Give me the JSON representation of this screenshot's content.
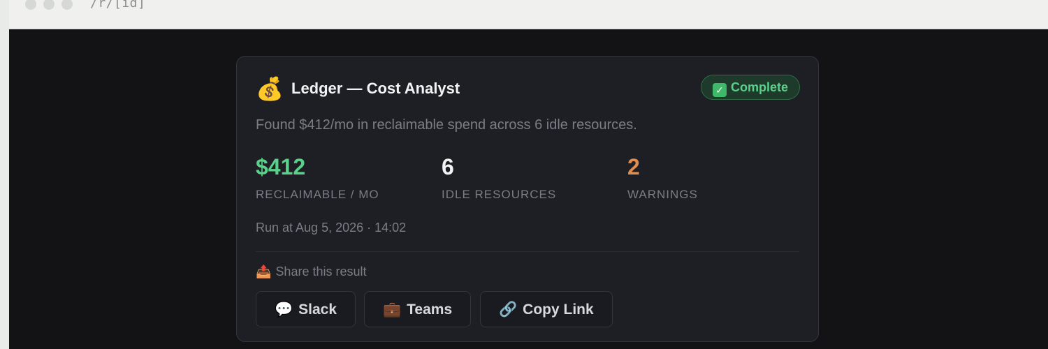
{
  "browser": {
    "url": "/r/[id]"
  },
  "card": {
    "icon": "money-bag-icon",
    "icon_glyph": "💰",
    "title": "Ledger — Cost Analyst",
    "status": {
      "label": "Complete",
      "icon": "check-box-icon",
      "icon_glyph": "✓",
      "color": "#5ad08a"
    },
    "summary": "Found $412/mo in reclaimable spend across 6 idle resources.",
    "stats": [
      {
        "value": "$412",
        "label": "RECLAIMABLE / MO",
        "color": "#5ad08a"
      },
      {
        "value": "6",
        "label": "IDLE RESOURCES",
        "color": "#f3f3f5"
      },
      {
        "value": "2",
        "label": "WARNINGS",
        "color": "#e08e4f"
      }
    ],
    "run_at": "Run at Aug 5, 2026 · 14:02",
    "share": {
      "label": "Share this result",
      "icon": "outbox-tray-icon",
      "icon_glyph": "📤",
      "buttons": [
        {
          "label": "Slack",
          "icon": "speech-bubble-icon",
          "icon_glyph": "💬"
        },
        {
          "label": "Teams",
          "icon": "briefcase-icon",
          "icon_glyph": "💼"
        },
        {
          "label": "Copy Link",
          "icon": "link-icon",
          "icon_glyph": "🔗"
        }
      ]
    }
  }
}
